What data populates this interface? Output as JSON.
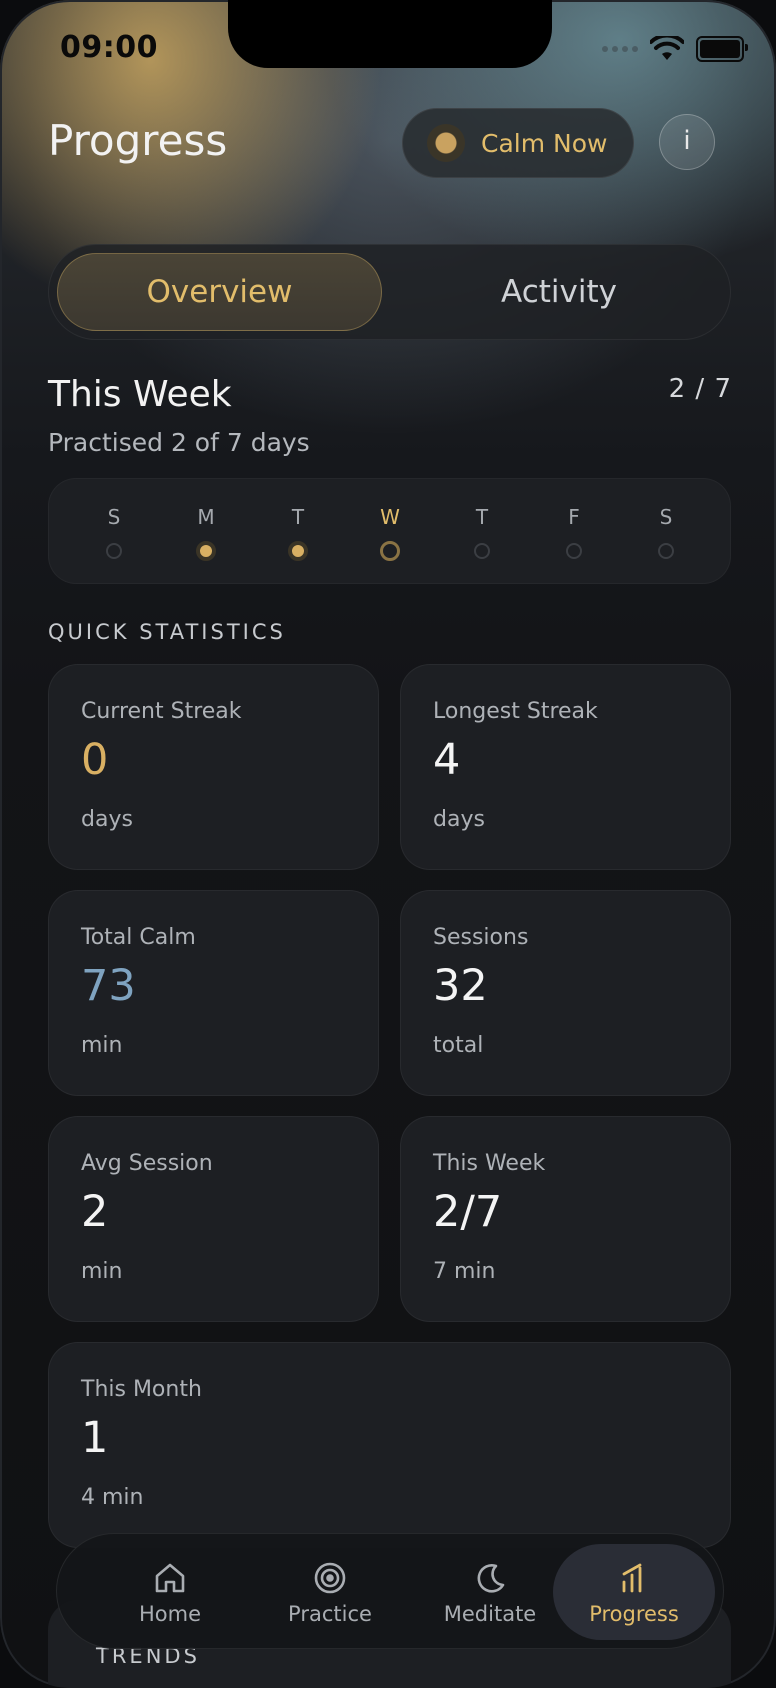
{
  "status_bar": {
    "time": "09:00"
  },
  "header": {
    "title": "Progress",
    "calm_button_label": "Calm Now",
    "info_button_label": "i"
  },
  "tabs": [
    {
      "label": "Overview",
      "active": true
    },
    {
      "label": "Activity",
      "active": false
    }
  ],
  "this_week": {
    "title": "This Week",
    "count": "2 / 7",
    "subtitle": "Practised 2 of 7 days",
    "days": [
      {
        "letter": "S",
        "state": "empty"
      },
      {
        "letter": "M",
        "state": "done"
      },
      {
        "letter": "T",
        "state": "done"
      },
      {
        "letter": "W",
        "state": "today"
      },
      {
        "letter": "T",
        "state": "empty"
      },
      {
        "letter": "F",
        "state": "empty"
      },
      {
        "letter": "S",
        "state": "empty"
      }
    ]
  },
  "quick_statistics": {
    "title": "QUICK STATISTICS",
    "cards": [
      {
        "label": "Current Streak",
        "value": "0",
        "unit": "days",
        "accent": "#d9b063"
      },
      {
        "label": "Longest Streak",
        "value": "4",
        "unit": "days"
      },
      {
        "label": "Total Calm",
        "value": "73",
        "unit": "min",
        "accent": "#7fa3c0"
      },
      {
        "label": "Sessions",
        "value": "32",
        "unit": "total"
      },
      {
        "label": "Avg Session",
        "value": "2",
        "unit": "min"
      },
      {
        "label": "This Week",
        "value": "2/7",
        "unit": "7 min"
      },
      {
        "label": "This Month",
        "value": "1",
        "unit": "4 min"
      }
    ]
  },
  "trends": {
    "title": "TRENDS"
  },
  "bottom_nav": {
    "items": [
      {
        "label": "Home",
        "icon": "home-icon"
      },
      {
        "label": "Practice",
        "icon": "target-icon"
      },
      {
        "label": "Meditate",
        "icon": "moon-icon"
      },
      {
        "label": "Progress",
        "icon": "bar-chart-icon",
        "active": true
      }
    ]
  },
  "colors": {
    "accent_gold": "#e2bd6b",
    "accent_blue": "#7fa3c0",
    "background": "#101113",
    "card": "#1d1f23"
  }
}
